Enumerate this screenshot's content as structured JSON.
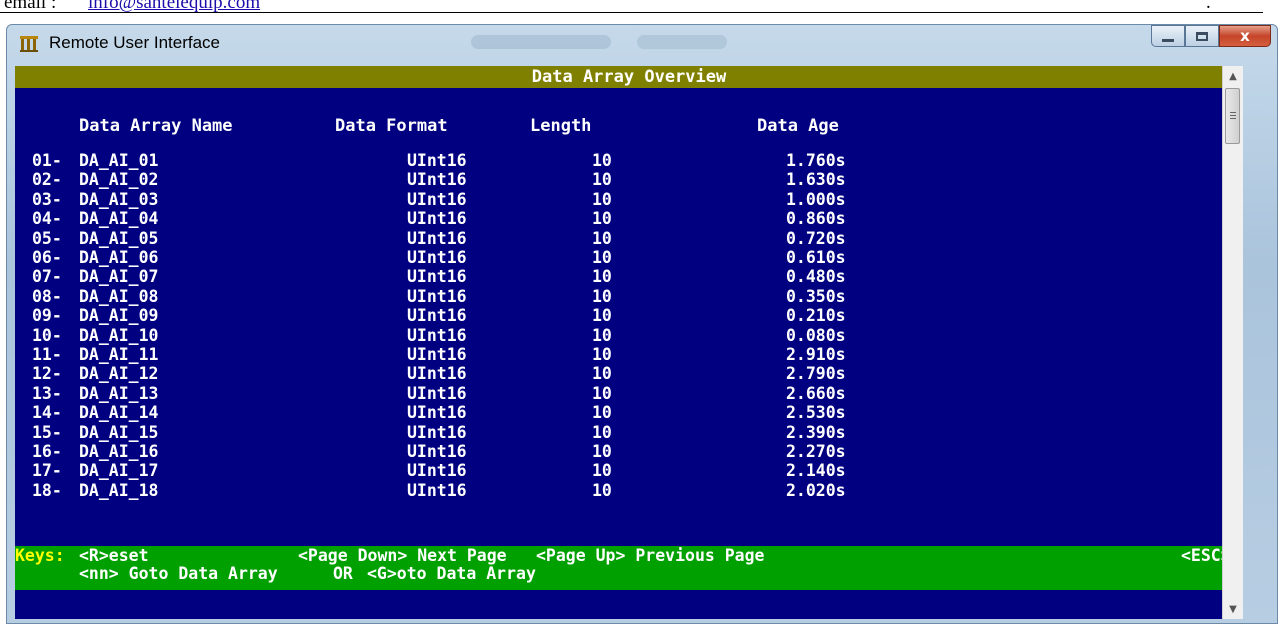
{
  "page": {
    "email_label": "email",
    "email_sep": ":",
    "email_link": "info@santelequip.com",
    "trailing_dot": "."
  },
  "window": {
    "title": "Remote User Interface",
    "close_glyph": "x"
  },
  "console": {
    "header": "Data Array Overview",
    "columns": {
      "name": "Data Array Name",
      "format": "Data Format",
      "length": "Length",
      "age": "Data Age"
    },
    "rows": [
      {
        "num": "01-",
        "name": "DA_AI_01",
        "format": "UInt16",
        "length": "10",
        "age": "1.760s"
      },
      {
        "num": "02-",
        "name": "DA_AI_02",
        "format": "UInt16",
        "length": "10",
        "age": "1.630s"
      },
      {
        "num": "03-",
        "name": "DA_AI_03",
        "format": "UInt16",
        "length": "10",
        "age": "1.000s"
      },
      {
        "num": "04-",
        "name": "DA_AI_04",
        "format": "UInt16",
        "length": "10",
        "age": "0.860s"
      },
      {
        "num": "05-",
        "name": "DA_AI_05",
        "format": "UInt16",
        "length": "10",
        "age": "0.720s"
      },
      {
        "num": "06-",
        "name": "DA_AI_06",
        "format": "UInt16",
        "length": "10",
        "age": "0.610s"
      },
      {
        "num": "07-",
        "name": "DA_AI_07",
        "format": "UInt16",
        "length": "10",
        "age": "0.480s"
      },
      {
        "num": "08-",
        "name": "DA_AI_08",
        "format": "UInt16",
        "length": "10",
        "age": "0.350s"
      },
      {
        "num": "09-",
        "name": "DA_AI_09",
        "format": "UInt16",
        "length": "10",
        "age": "0.210s"
      },
      {
        "num": "10-",
        "name": "DA_AI_10",
        "format": "UInt16",
        "length": "10",
        "age": "0.080s"
      },
      {
        "num": "11-",
        "name": "DA_AI_11",
        "format": "UInt16",
        "length": "10",
        "age": "2.910s"
      },
      {
        "num": "12-",
        "name": "DA_AI_12",
        "format": "UInt16",
        "length": "10",
        "age": "2.790s"
      },
      {
        "num": "13-",
        "name": "DA_AI_13",
        "format": "UInt16",
        "length": "10",
        "age": "2.660s"
      },
      {
        "num": "14-",
        "name": "DA_AI_14",
        "format": "UInt16",
        "length": "10",
        "age": "2.530s"
      },
      {
        "num": "15-",
        "name": "DA_AI_15",
        "format": "UInt16",
        "length": "10",
        "age": "2.390s"
      },
      {
        "num": "16-",
        "name": "DA_AI_16",
        "format": "UInt16",
        "length": "10",
        "age": "2.270s"
      },
      {
        "num": "17-",
        "name": "DA_AI_17",
        "format": "UInt16",
        "length": "10",
        "age": "2.140s"
      },
      {
        "num": "18-",
        "name": "DA_AI_18",
        "format": "UInt16",
        "length": "10",
        "age": "2.020s"
      }
    ],
    "keys": {
      "label": "Keys:",
      "reset": "<R>eset",
      "page_down": "<Page Down> Next Page",
      "page_up": "<Page Up> Previous Page",
      "esc": "<ESC>",
      "goto_nn": "<nn> Goto Data Array",
      "or": "OR",
      "goto_g": "<G>oto Data Array"
    }
  },
  "colors": {
    "console_bg": "#000080",
    "header_bar": "#808000",
    "keys_bar": "#00a000",
    "keys_highlight": "#ffff00",
    "text": "#ffffff"
  }
}
